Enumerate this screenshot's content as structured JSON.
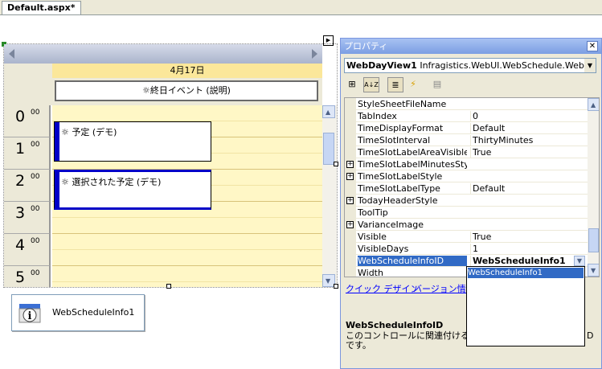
{
  "tabs": [
    {
      "label": "Default.aspx*"
    }
  ],
  "dayview": {
    "date_header": "4月17日",
    "allday_event": "終日イベント (説明)",
    "hours": [
      {
        "hour": "0",
        "minutes": "00"
      },
      {
        "hour": "1",
        "minutes": "00"
      },
      {
        "hour": "2",
        "minutes": "00"
      },
      {
        "hour": "3",
        "minutes": "00"
      },
      {
        "hour": "4",
        "minutes": "00"
      },
      {
        "hour": "5",
        "minutes": "00"
      }
    ],
    "appointments": [
      {
        "text": "予定 (デモ)"
      },
      {
        "text": "選択された予定 (デモ)"
      }
    ]
  },
  "info_component": {
    "label": "WebScheduleInfo1"
  },
  "properties": {
    "title": "プロパティ",
    "close_glyph": "✕",
    "selected_object": "WebDayView1",
    "selected_type": "Infragistics.WebUI.WebSchedule.WebDayV",
    "toolbar": {
      "categorized": "⊞",
      "alpha": "A↓Z",
      "props": "≣",
      "events": "⚡",
      "pages": "▤"
    },
    "rows": [
      {
        "name": "StyleSheetFileName",
        "value": "",
        "expandable": false
      },
      {
        "name": "TabIndex",
        "value": "0",
        "expandable": false
      },
      {
        "name": "TimeDisplayFormat",
        "value": "Default",
        "expandable": false
      },
      {
        "name": "TimeSlotInterval",
        "value": "ThirtyMinutes",
        "expandable": false
      },
      {
        "name": "TimeSlotLabelAreaVisible",
        "value": "True",
        "expandable": false
      },
      {
        "name": "TimeSlotLabelMinutesStyle",
        "value": "",
        "expandable": true
      },
      {
        "name": "TimeSlotLabelStyle",
        "value": "",
        "expandable": true
      },
      {
        "name": "TimeSlotLabelType",
        "value": "Default",
        "expandable": false
      },
      {
        "name": "TodayHeaderStyle",
        "value": "",
        "expandable": true
      },
      {
        "name": "ToolTip",
        "value": "",
        "expandable": false
      },
      {
        "name": "VarianceImage",
        "value": "",
        "expandable": true
      },
      {
        "name": "Visible",
        "value": "True",
        "expandable": false
      },
      {
        "name": "VisibleDays",
        "value": "1",
        "expandable": false
      },
      {
        "name": "WebScheduleInfoID",
        "value": "WebScheduleInfo1",
        "expandable": false,
        "selected": true
      },
      {
        "name": "Width",
        "value": "",
        "expandable": false
      }
    ],
    "dropdown_option": "WebScheduleInfo1",
    "links": [
      "クイック デザイン",
      "バージョン情報"
    ],
    "description_title": "WebScheduleInfoID",
    "description_text": "このコントロールに関連付ける W",
    "description_text2": "です。",
    "description_overflow": "D"
  }
}
